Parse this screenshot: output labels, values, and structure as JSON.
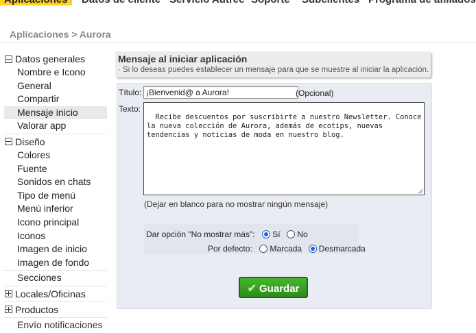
{
  "topnav": {
    "tabs": [
      {
        "label": "Aplicaciones",
        "active": true
      },
      {
        "label": "Datos de cliente"
      },
      {
        "label": "Servicio Autrec"
      },
      {
        "label": "Soporte"
      },
      {
        "label": "Subclientes"
      },
      {
        "label": "Programa de afiliados"
      }
    ]
  },
  "breadcrumb": "Aplicaciones > Aurora",
  "sidebar": {
    "datos_generales": {
      "label": "Datos generales",
      "items": [
        "Nombre e Icono",
        "General",
        "Compartir",
        "Mensaje inicio",
        "Valorar app"
      ]
    },
    "diseno": {
      "label": "Diseño",
      "items": [
        "Colores",
        "Fuente",
        "Sonidos en chats",
        "Tipo de menú",
        "Menú inferior",
        "Icono principal",
        "Iconos",
        "Imagen de inicio",
        "Imagen de fondo"
      ]
    },
    "secciones": "Secciones",
    "locales": "Locales/Oficinas",
    "productos": "Productos",
    "envio": "Envío notificaciones"
  },
  "header": {
    "title": "Mensaje al iniciar aplicación",
    "subtitle": "· Si lo deseas puedes establecer un mensaje para que se muestre al iniciar la aplicación."
  },
  "form": {
    "title_label": "Título:",
    "title_value": "¡Bienvenid@ a Aurora!",
    "optional": "(Opcional)",
    "text_label": "Texto:",
    "text_value": "Recibe descuentos por suscribirte a nuestro Newsletter. Conoce\nla nueva colección de Aurora, además de ecotips, nuevas\ntendencias y noticias de moda en nuestro blog.",
    "hint": "(Dejar en blanco para no mostrar ningún mensaje)",
    "option_label": "Dar opción \"No mostrar más\":",
    "option_yes": "Sí",
    "option_no": "No",
    "default_label": "Por defecto:",
    "default_checked": "Marcada",
    "default_unchecked": "Desmarcada",
    "save": "Guardar"
  }
}
